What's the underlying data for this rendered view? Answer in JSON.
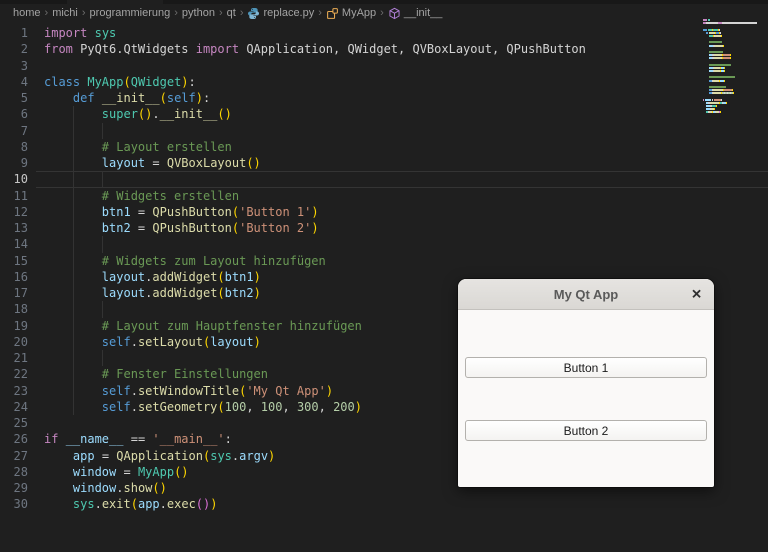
{
  "breadcrumb": {
    "separator": "›",
    "items": [
      {
        "label": "home"
      },
      {
        "label": "michi"
      },
      {
        "label": "programmierung"
      },
      {
        "label": "python"
      },
      {
        "label": "qt"
      },
      {
        "label": "replace.py",
        "icon": "python-icon"
      },
      {
        "label": "MyApp",
        "icon": "class-icon"
      },
      {
        "label": "__init__",
        "icon": "method-icon"
      }
    ]
  },
  "editor": {
    "current_line": 10,
    "colors": {
      "kw": "#C586C0",
      "kw2": "#569CD6",
      "cls": "#4EC9B0",
      "fn": "#DCDCAA",
      "var": "#9CDCFE",
      "txt": "#D4D4D4",
      "str": "#CE9178",
      "num": "#B5CEA8",
      "com": "#6A9955",
      "br1": "#FFD700",
      "br2": "#DA70D6",
      "background": "#1F1F1F",
      "gutter": "#6E7681",
      "gutter_active": "#C6C6C6"
    },
    "lines": [
      {
        "n": 1,
        "tokens": [
          [
            "import",
            "kw"
          ],
          [
            " ",
            "txt"
          ],
          [
            "sys",
            "cls"
          ]
        ]
      },
      {
        "n": 2,
        "tokens": [
          [
            "from",
            "kw"
          ],
          [
            " PyQt6.QtWidgets ",
            "txt"
          ],
          [
            "import",
            "kw"
          ],
          [
            " QApplication, QWidget, QVBoxLayout, QPushButton",
            "txt"
          ]
        ]
      },
      {
        "n": 3,
        "tokens": []
      },
      {
        "n": 4,
        "tokens": [
          [
            "class",
            "kw2"
          ],
          [
            " ",
            "txt"
          ],
          [
            "MyApp",
            "cls"
          ],
          [
            "(",
            "br1"
          ],
          [
            "QWidget",
            "cls"
          ],
          [
            ")",
            "br1"
          ],
          [
            ":",
            "txt"
          ]
        ]
      },
      {
        "n": 5,
        "tokens": [
          [
            "    ",
            "txt"
          ],
          [
            "def",
            "kw2"
          ],
          [
            " ",
            "txt"
          ],
          [
            "__init__",
            "fn"
          ],
          [
            "(",
            "br1"
          ],
          [
            "self",
            "kw2"
          ],
          [
            ")",
            "br1"
          ],
          [
            ":",
            "txt"
          ]
        ]
      },
      {
        "n": 6,
        "tokens": [
          [
            "        ",
            "txt"
          ],
          [
            "super",
            "cls"
          ],
          [
            "()",
            "br1"
          ],
          [
            ".",
            "txt"
          ],
          [
            "__init__",
            "fn"
          ],
          [
            "()",
            "br1"
          ]
        ]
      },
      {
        "n": 7,
        "tokens": []
      },
      {
        "n": 8,
        "tokens": [
          [
            "        ",
            "txt"
          ],
          [
            "# Layout erstellen",
            "com"
          ]
        ]
      },
      {
        "n": 9,
        "tokens": [
          [
            "        ",
            "txt"
          ],
          [
            "layout",
            "var"
          ],
          [
            " = ",
            "txt"
          ],
          [
            "QVBoxLayout",
            "fn"
          ],
          [
            "()",
            "br1"
          ]
        ]
      },
      {
        "n": 10,
        "tokens": []
      },
      {
        "n": 11,
        "tokens": [
          [
            "        ",
            "txt"
          ],
          [
            "# Widgets erstellen",
            "com"
          ]
        ]
      },
      {
        "n": 12,
        "tokens": [
          [
            "        ",
            "txt"
          ],
          [
            "btn1",
            "var"
          ],
          [
            " = ",
            "txt"
          ],
          [
            "QPushButton",
            "fn"
          ],
          [
            "(",
            "br1"
          ],
          [
            "'Button 1'",
            "str"
          ],
          [
            ")",
            "br1"
          ]
        ]
      },
      {
        "n": 13,
        "tokens": [
          [
            "        ",
            "txt"
          ],
          [
            "btn2",
            "var"
          ],
          [
            " = ",
            "txt"
          ],
          [
            "QPushButton",
            "fn"
          ],
          [
            "(",
            "br1"
          ],
          [
            "'Button 2'",
            "str"
          ],
          [
            ")",
            "br1"
          ]
        ]
      },
      {
        "n": 14,
        "tokens": []
      },
      {
        "n": 15,
        "tokens": [
          [
            "        ",
            "txt"
          ],
          [
            "# Widgets zum Layout hinzufügen",
            "com"
          ]
        ]
      },
      {
        "n": 16,
        "tokens": [
          [
            "        ",
            "txt"
          ],
          [
            "layout",
            "var"
          ],
          [
            ".",
            "txt"
          ],
          [
            "addWidget",
            "fn"
          ],
          [
            "(",
            "br1"
          ],
          [
            "btn1",
            "var"
          ],
          [
            ")",
            "br1"
          ]
        ]
      },
      {
        "n": 17,
        "tokens": [
          [
            "        ",
            "txt"
          ],
          [
            "layout",
            "var"
          ],
          [
            ".",
            "txt"
          ],
          [
            "addWidget",
            "fn"
          ],
          [
            "(",
            "br1"
          ],
          [
            "btn2",
            "var"
          ],
          [
            ")",
            "br1"
          ]
        ]
      },
      {
        "n": 18,
        "tokens": []
      },
      {
        "n": 19,
        "tokens": [
          [
            "        ",
            "txt"
          ],
          [
            "# Layout zum Hauptfenster hinzufügen",
            "com"
          ]
        ]
      },
      {
        "n": 20,
        "tokens": [
          [
            "        ",
            "txt"
          ],
          [
            "self",
            "kw2"
          ],
          [
            ".",
            "txt"
          ],
          [
            "setLayout",
            "fn"
          ],
          [
            "(",
            "br1"
          ],
          [
            "layout",
            "var"
          ],
          [
            ")",
            "br1"
          ]
        ]
      },
      {
        "n": 21,
        "tokens": []
      },
      {
        "n": 22,
        "tokens": [
          [
            "        ",
            "txt"
          ],
          [
            "# Fenster Einstellungen",
            "com"
          ]
        ]
      },
      {
        "n": 23,
        "tokens": [
          [
            "        ",
            "txt"
          ],
          [
            "self",
            "kw2"
          ],
          [
            ".",
            "txt"
          ],
          [
            "setWindowTitle",
            "fn"
          ],
          [
            "(",
            "br1"
          ],
          [
            "'My Qt App'",
            "str"
          ],
          [
            ")",
            "br1"
          ]
        ]
      },
      {
        "n": 24,
        "tokens": [
          [
            "        ",
            "txt"
          ],
          [
            "self",
            "kw2"
          ],
          [
            ".",
            "txt"
          ],
          [
            "setGeometry",
            "fn"
          ],
          [
            "(",
            "br1"
          ],
          [
            "100",
            "num"
          ],
          [
            ", ",
            "txt"
          ],
          [
            "100",
            "num"
          ],
          [
            ", ",
            "txt"
          ],
          [
            "300",
            "num"
          ],
          [
            ", ",
            "txt"
          ],
          [
            "200",
            "num"
          ],
          [
            ")",
            "br1"
          ]
        ]
      },
      {
        "n": 25,
        "tokens": []
      },
      {
        "n": 26,
        "tokens": [
          [
            "if",
            "kw"
          ],
          [
            " ",
            "txt"
          ],
          [
            "__name__",
            "var"
          ],
          [
            " ",
            "txt"
          ],
          [
            "==",
            "txt"
          ],
          [
            " ",
            "txt"
          ],
          [
            "'__main__'",
            "str"
          ],
          [
            ":",
            "txt"
          ]
        ]
      },
      {
        "n": 27,
        "tokens": [
          [
            "    ",
            "txt"
          ],
          [
            "app",
            "var"
          ],
          [
            " = ",
            "txt"
          ],
          [
            "QApplication",
            "fn"
          ],
          [
            "(",
            "br1"
          ],
          [
            "sys",
            "cls"
          ],
          [
            ".",
            "txt"
          ],
          [
            "argv",
            "var"
          ],
          [
            ")",
            "br1"
          ]
        ]
      },
      {
        "n": 28,
        "tokens": [
          [
            "    ",
            "txt"
          ],
          [
            "window",
            "var"
          ],
          [
            " = ",
            "txt"
          ],
          [
            "MyApp",
            "cls"
          ],
          [
            "()",
            "br1"
          ]
        ]
      },
      {
        "n": 29,
        "tokens": [
          [
            "    ",
            "txt"
          ],
          [
            "window",
            "var"
          ],
          [
            ".",
            "txt"
          ],
          [
            "show",
            "fn"
          ],
          [
            "()",
            "br1"
          ]
        ]
      },
      {
        "n": 30,
        "tokens": [
          [
            "    ",
            "txt"
          ],
          [
            "sys",
            "cls"
          ],
          [
            ".",
            "txt"
          ],
          [
            "exit",
            "fn"
          ],
          [
            "(",
            "br1"
          ],
          [
            "app",
            "var"
          ],
          [
            ".",
            "txt"
          ],
          [
            "exec",
            "fn"
          ],
          [
            "()",
            "br2"
          ],
          [
            ")",
            "br1"
          ]
        ]
      }
    ]
  },
  "qt_window": {
    "title": "My Qt App",
    "close_label": "✕",
    "buttons": [
      "Button 1",
      "Button 2"
    ],
    "titlebar_color": "#DFDDD9",
    "body_color": "#FAF9F8"
  }
}
